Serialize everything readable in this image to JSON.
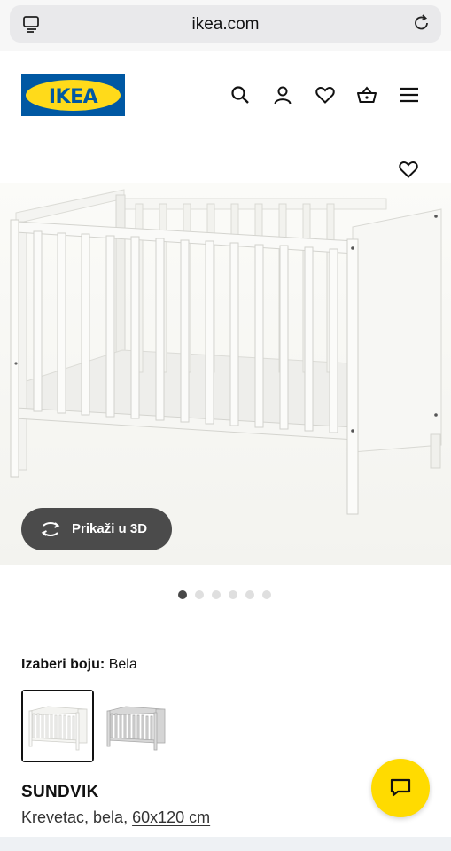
{
  "browser": {
    "url": "ikea.com",
    "tabs_icon": "tabs-icon",
    "reload_icon": "reload-icon"
  },
  "header": {
    "logo_text": "IKEA",
    "icons": [
      "search-icon",
      "account-icon",
      "favorites-icon",
      "cart-icon",
      "menu-icon"
    ]
  },
  "product_image": {
    "favorite_icon": "heart-icon",
    "view_3d_label": "Prikaži u 3D",
    "carousel": {
      "count": 6,
      "active_index": 0
    }
  },
  "color_picker": {
    "label": "Izaberi boju:",
    "selected_value": "Bela",
    "swatches": [
      "white-crib-swatch",
      "grey-crib-swatch"
    ]
  },
  "product": {
    "name": "SUNDVIK",
    "description_prefix": "Krevetac, bela,",
    "size": "60x120 cm"
  },
  "chat": {
    "icon": "chat-icon"
  },
  "colors": {
    "ikea_blue": "#0058a3",
    "ikea_yellow": "#ffda1a",
    "dark_button": "#4b4b4b",
    "chat_yellow": "#ffdb00"
  }
}
